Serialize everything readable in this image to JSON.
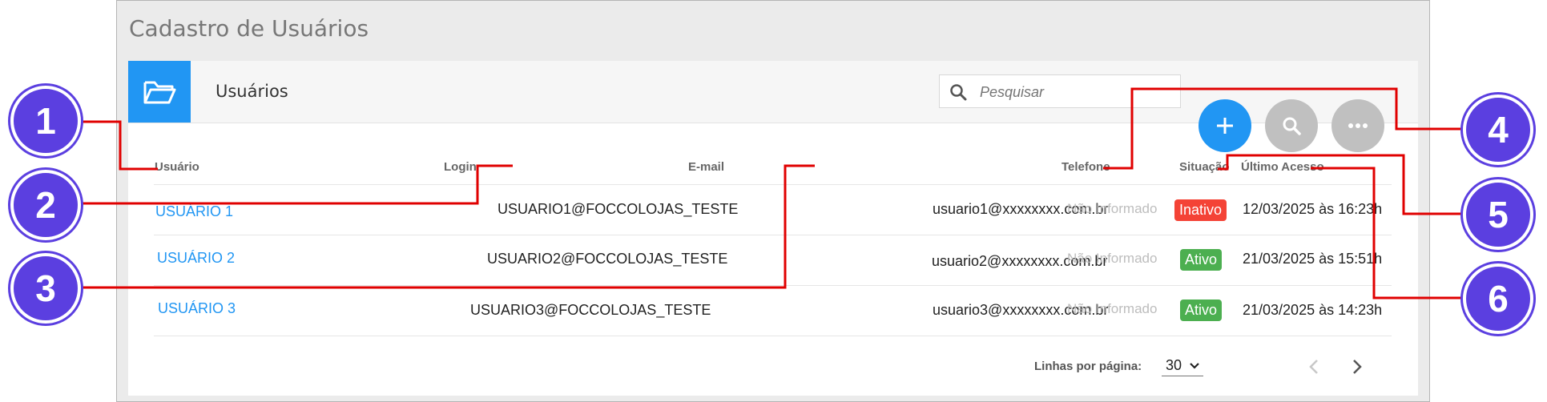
{
  "page_title": "Cadastro de Usuários",
  "card_title": "Usuários",
  "search": {
    "placeholder": "Pesquisar"
  },
  "columns": {
    "usuario": "Usuário",
    "login": "Login",
    "email": "E-mail",
    "telefone": "Telefone",
    "situacao": "Situação",
    "ultimo_acesso": "Último Acesso"
  },
  "rows": [
    {
      "usuario": "USUÁRIO 1",
      "login": "USUARIO1@FOCCOLOJAS_TESTE",
      "email": "usuario1@xxxxxxxx.com.br",
      "telefone": "Não Informado",
      "situacao": "Inativo",
      "ultimo_acesso": "12/03/2025 às 16:23h"
    },
    {
      "usuario": "USUÁRIO 2",
      "login": "USUARIO2@FOCCOLOJAS_TESTE",
      "email": "usuario2@xxxxxxxx.com.br",
      "telefone": "Não Informado",
      "situacao": "Ativo",
      "ultimo_acesso": "21/03/2025 às 15:51h"
    },
    {
      "usuario": "USUÁRIO 3",
      "login": "USUARIO3@FOCCOLOJAS_TESTE",
      "email": "usuario3@xxxxxxxx.com.br",
      "telefone": "Não Informado",
      "situacao": "Ativo",
      "ultimo_acesso": "21/03/2025 às 14:23h"
    }
  ],
  "footer": {
    "rows_per_page_label": "Linhas por página:",
    "rows_per_page_value": "30"
  },
  "callouts": [
    "1",
    "2",
    "3",
    "4",
    "5",
    "6"
  ],
  "icons": {
    "folder": "folder-icon",
    "search": "search-icon",
    "add": "plus-icon",
    "more": "more-icon",
    "prev": "chevron-left-icon",
    "next": "chevron-right-icon"
  },
  "colors": {
    "accent": "#2196f3",
    "inactive": "#f44336",
    "active": "#4caf50",
    "callout": "#5b3fe0",
    "annotation_line": "#e00000"
  }
}
